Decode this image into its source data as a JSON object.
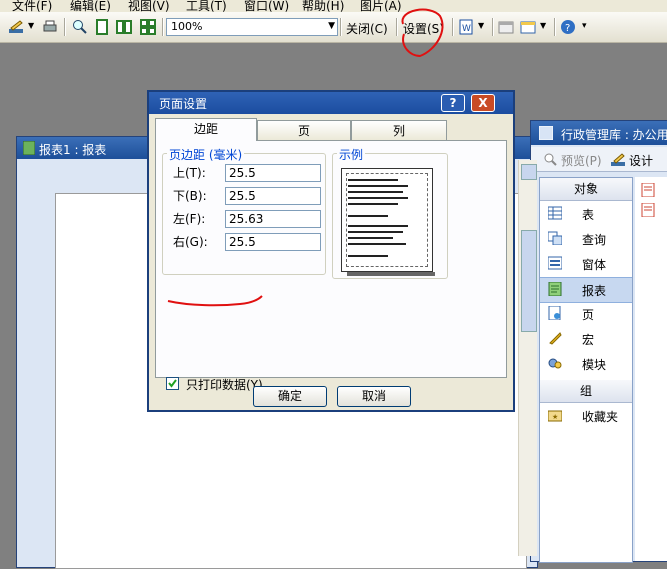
{
  "menu": {
    "file": "文件(F)",
    "edit": "编辑(E)",
    "view": "视图(V)",
    "tools": "工具(T)",
    "window": "窗口(W)",
    "help": "帮助(H)",
    "image": "图片(A)"
  },
  "toolbar": {
    "zoom_value": "100%",
    "close_label": "关闭(C)",
    "setup_label": "设置(S)"
  },
  "report_window": {
    "title": "报表1 : 报表"
  },
  "db_window": {
    "title": "行政管理库 : 办公用品",
    "preview_label": "预览(P)",
    "design_label": "设计",
    "objects_header": "对象",
    "items": [
      {
        "label": "表",
        "icon": "table-icon"
      },
      {
        "label": "查询",
        "icon": "query-icon"
      },
      {
        "label": "窗体",
        "icon": "form-icon"
      },
      {
        "label": "报表",
        "icon": "report-icon",
        "selected": true
      },
      {
        "label": "页",
        "icon": "page-icon"
      },
      {
        "label": "宏",
        "icon": "macro-icon"
      },
      {
        "label": "模块",
        "icon": "module-icon"
      }
    ],
    "groups_header": "组",
    "favorites_label": "收藏夹"
  },
  "dialog": {
    "title": "页面设置",
    "help_glyph": "?",
    "close_glyph": "X",
    "tabs": [
      "边距",
      "页",
      "列"
    ],
    "margins_group_label": "页边距 (毫米)",
    "sample_group_label": "示例",
    "fields": [
      {
        "label": "上(T):",
        "value": "25.5"
      },
      {
        "label": "下(B):",
        "value": "25.5"
      },
      {
        "label": "左(F):",
        "value": "25.63"
      },
      {
        "label": "右(G):",
        "value": "25.5"
      }
    ],
    "print_data_only_label": "只打印数据(Y)",
    "print_data_only_checked": true,
    "ok_label": "确定",
    "cancel_label": "取消"
  },
  "colors": {
    "annotation": "#e01010",
    "titlebar": "#1d4f99",
    "desktop": "#808080"
  }
}
